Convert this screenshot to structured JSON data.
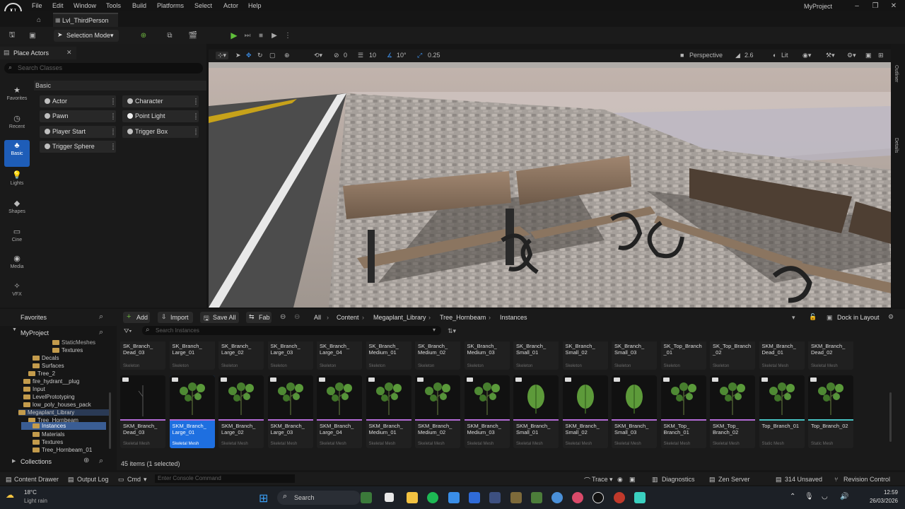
{
  "menu": {
    "items": [
      "File",
      "Edit",
      "Window",
      "Tools",
      "Build",
      "Platforms",
      "Select",
      "Actor",
      "Help"
    ],
    "project_name": "MyProject",
    "logo_letter": "U"
  },
  "level_tab": {
    "label": "Lvl_ThirdPerson"
  },
  "toolbar": {
    "selection_mode": "Selection Mode"
  },
  "place_actors": {
    "tab_label": "Place Actors",
    "search_placeholder": "Search Classes",
    "section_header": "Basic",
    "categories": [
      "Favorites",
      "Recent",
      "Basic",
      "Lights",
      "Shapes",
      "Cine",
      "Media",
      "VFX"
    ],
    "actors": [
      "Actor",
      "Character",
      "Pawn",
      "Point Light",
      "Player Start",
      "Trigger Box",
      "Trigger Sphere"
    ]
  },
  "viewport": {
    "translate_snap": "10",
    "rotate_snap": "10°",
    "scale_snap": "0.25",
    "view_mode": "Perspective",
    "fov": "2.6",
    "lit": "Lit",
    "side_tabs": [
      "Outliner",
      "Details"
    ],
    "toolbar_zero": "0"
  },
  "content_browser": {
    "favorites": "Favorites",
    "project": "MyProject",
    "collections": "Collections",
    "add": "Add",
    "import": "Import",
    "save_all": "Save All",
    "fab": "Fab",
    "breadcrumbs": [
      "All",
      "Content",
      "Megaplant_Library",
      "Tree_Hornbeam",
      "Instances"
    ],
    "dock": "Dock in Layout",
    "search_placeholder": "Search Instances",
    "status": "45 items (1 selected)",
    "tree": [
      "StaticMeshes",
      "Textures",
      "Decals",
      "Surfaces",
      "Tree_2",
      "fire_hydrant__plug",
      "Input",
      "LevelPrototyping",
      "low_poly_houses_pack",
      "Megaplant_Library",
      "Tree_Hornbeam",
      "Instances",
      "Materials",
      "Textures",
      "Tree_Hornbeam_01"
    ],
    "top_row": [
      {
        "name": "SK_Branch_\nDead_03",
        "type": "Skeleton"
      },
      {
        "name": "SK_Branch_\nLarge_01",
        "type": "Skeleton"
      },
      {
        "name": "SK_Branch_\nLarge_02",
        "type": "Skeleton"
      },
      {
        "name": "SK_Branch_\nLarge_03",
        "type": "Skeleton"
      },
      {
        "name": "SK_Branch_\nLarge_04",
        "type": "Skeleton"
      },
      {
        "name": "SK_Branch_\nMedium_01",
        "type": "Skeleton"
      },
      {
        "name": "SK_Branch_\nMedium_02",
        "type": "Skeleton"
      },
      {
        "name": "SK_Branch_\nMedium_03",
        "type": "Skeleton"
      },
      {
        "name": "SK_Branch_\nSmall_01",
        "type": "Skeleton"
      },
      {
        "name": "SK_Branch_\nSmall_02",
        "type": "Skeleton"
      },
      {
        "name": "SK_Branch_\nSmall_03",
        "type": "Skeleton"
      },
      {
        "name": "SK_Top_Branch\n_01",
        "type": "Skeleton"
      },
      {
        "name": "SK_Top_Branch\n_02",
        "type": "Skeleton"
      },
      {
        "name": "SKM_Branch_\nDead_01",
        "type": "Skeletal Mesh"
      },
      {
        "name": "SKM_Branch_\nDead_02",
        "type": "Skeletal Mesh"
      }
    ],
    "bottom_row": [
      {
        "name": "SKM_Branch_\nDead_03",
        "type": "Skeletal Mesh"
      },
      {
        "name": "SKM_Branch_\nLarge_01",
        "type": "Skeletal Mesh"
      },
      {
        "name": "SKM_Branch_\nLarge_02",
        "type": "Skeletal Mesh"
      },
      {
        "name": "SKM_Branch_\nLarge_03",
        "type": "Skeletal Mesh"
      },
      {
        "name": "SKM_Branch_\nLarge_04",
        "type": "Skeletal Mesh"
      },
      {
        "name": "SKM_Branch_\nMedium_01",
        "type": "Skeletal Mesh"
      },
      {
        "name": "SKM_Branch_\nMedium_02",
        "type": "Skeletal Mesh"
      },
      {
        "name": "SKM_Branch_\nMedium_03",
        "type": "Skeletal Mesh"
      },
      {
        "name": "SKM_Branch_\nSmall_01",
        "type": "Skeletal Mesh"
      },
      {
        "name": "SKM_Branch_\nSmall_02",
        "type": "Skeletal Mesh"
      },
      {
        "name": "SKM_Branch_\nSmall_03",
        "type": "Skeletal Mesh"
      },
      {
        "name": "SKM_Top_\nBranch_01",
        "type": "Skeletal Mesh"
      },
      {
        "name": "SKM_Top_\nBranch_02",
        "type": "Skeletal Mesh"
      },
      {
        "name": "Top_Branch_01",
        "type": "Static Mesh"
      },
      {
        "name": "Top_Branch_02",
        "type": "Static Mesh"
      }
    ]
  },
  "status_bar": {
    "content_drawer": "Content Drawer",
    "output_log": "Output Log",
    "cmd": "Cmd",
    "console_placeholder": "Enter Console Command",
    "trace": "Trace",
    "diagnostics": "Diagnostics",
    "zen_server": "Zen Server",
    "unsaved": "314 Unsaved",
    "revision_control": "Revision Control"
  },
  "taskbar": {
    "temperature": "18°C",
    "weather": "Light rain",
    "search": "Search",
    "time": "12:59",
    "date": "26/03/2026"
  },
  "colors": {
    "accent": "#1e5db8",
    "selected": "#1e6fe0",
    "folder": "#c39b4c",
    "play": "#5fbf3a"
  }
}
